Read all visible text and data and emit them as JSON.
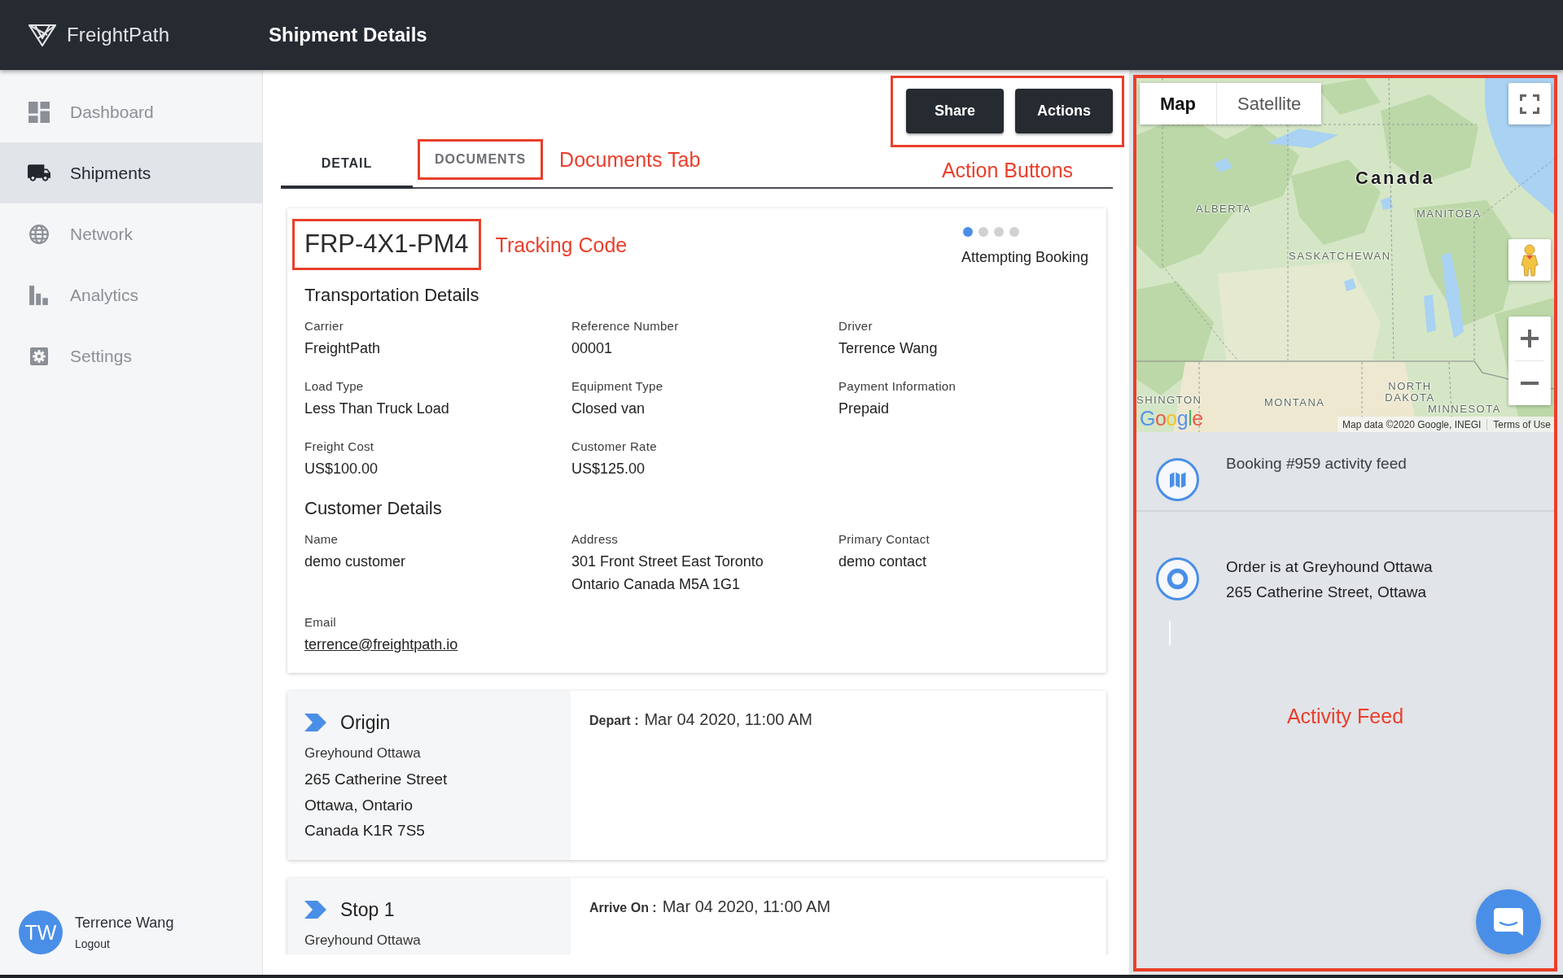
{
  "header": {
    "brand": "FreightPath",
    "title": "Shipment Details"
  },
  "sidebar": {
    "items": [
      {
        "label": "Dashboard",
        "selected": false
      },
      {
        "label": "Shipments",
        "selected": true
      },
      {
        "label": "Network",
        "selected": false
      },
      {
        "label": "Analytics",
        "selected": false
      },
      {
        "label": "Settings",
        "selected": false
      }
    ],
    "user": {
      "initials": "TW",
      "name": "Terrence Wang",
      "logout": "Logout"
    }
  },
  "tabs": {
    "items": [
      {
        "label": "DETAIL",
        "selected": true,
        "highlighted": false
      },
      {
        "label": "DOCUMENTS",
        "selected": false,
        "highlighted": true
      }
    ],
    "note": "Documents Tab"
  },
  "toolbar": {
    "buttons": [
      {
        "label": "Share"
      },
      {
        "label": "Actions"
      }
    ],
    "highlighted": true,
    "note": "Action Buttons"
  },
  "shipment": {
    "tracking_code": {
      "text": "FRP-4X1-PM4",
      "highlighted": true,
      "note": "Tracking Code"
    },
    "status": {
      "label": "Attempting Booking",
      "steps": [
        {
          "active": true
        },
        {
          "active": false
        },
        {
          "active": false
        },
        {
          "active": false
        }
      ]
    },
    "sections": [
      {
        "title": "Transportation Details",
        "fields": [
          {
            "label": "Carrier",
            "value": "FreightPath",
            "kind": "text"
          },
          {
            "label": "Reference Number",
            "value": "00001",
            "kind": "text"
          },
          {
            "label": "Driver",
            "value": "Terrence Wang",
            "kind": "text"
          },
          {
            "label": "Load Type",
            "value": "Less Than Truck Load",
            "kind": "text"
          },
          {
            "label": "Equipment Type",
            "value": "Closed van",
            "kind": "text"
          },
          {
            "label": "Payment Information",
            "value": "Prepaid",
            "kind": "text"
          },
          {
            "label": "Freight Cost",
            "value": "US$100.00",
            "kind": "text"
          },
          {
            "label": "Customer Rate",
            "value": "US$125.00",
            "kind": "text"
          }
        ]
      },
      {
        "title": "Customer Details",
        "fields": [
          {
            "label": "Name",
            "value": "demo customer",
            "kind": "text"
          },
          {
            "label": "Address",
            "value": "301 Front Street East Toronto\nOntario Canada M5A 1G1",
            "kind": "text"
          },
          {
            "label": "Primary Contact",
            "value": "demo contact",
            "kind": "text"
          },
          {
            "label": "Email",
            "value": "terrence@freightpath.io",
            "kind": "link"
          }
        ]
      }
    ]
  },
  "stops": [
    {
      "title": "Origin",
      "place": "Greyhound Ottawa",
      "address": "265 Catherine Street\nOttawa, Ontario\nCanada K1R 7S5",
      "time_label": "Depart :",
      "time": "Mar 04 2020, 11:00 AM"
    },
    {
      "title": "Stop 1",
      "place": "Greyhound Ottawa",
      "time_label": "Arrive On :",
      "time": "Mar 04 2020, 11:00 AM"
    }
  ],
  "side_panel": {
    "highlighted": true,
    "map": {
      "modes": [
        {
          "label": "Map",
          "selected": true
        },
        {
          "label": "Satellite",
          "selected": false
        }
      ],
      "labels": [
        {
          "text": "Canada",
          "kind": "country"
        },
        {
          "text": "ALBERTA",
          "kind": "region"
        },
        {
          "text": "MANITOBA",
          "kind": "region"
        },
        {
          "text": "SASKATCHEWAN",
          "kind": "region"
        },
        {
          "text": "SHINGTON",
          "kind": "region"
        },
        {
          "text": "MONTANA",
          "kind": "region"
        },
        {
          "text": "NORTH DAKOTA",
          "kind": "region"
        },
        {
          "text": "MINNESOTA",
          "kind": "region"
        }
      ],
      "logo": "Google",
      "attribution": "Map data ©2020 Google, INEGI",
      "terms": "Terms of Use"
    },
    "activity_feed": {
      "items": [
        {
          "kind": "booking",
          "title": "Booking #959 activity feed"
        },
        {
          "kind": "stop",
          "title": "Order is at Greyhound Ottawa",
          "subtitle": "265 Catherine Street, Ottawa"
        }
      ],
      "note": "Activity Feed"
    }
  }
}
